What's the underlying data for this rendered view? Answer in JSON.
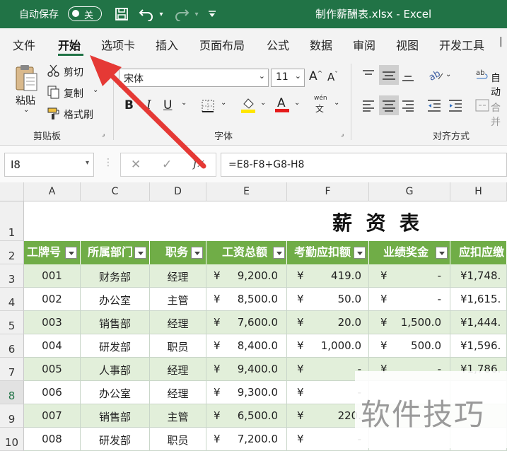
{
  "titlebar": {
    "autosave_label": "自动保存",
    "autosave_state": "关",
    "document_title": "制作薪酬表.xlsx  -  Excel",
    "bg_color": "#217346"
  },
  "tabs": [
    "文件",
    "开始",
    "选项卡",
    "插入",
    "页面布局",
    "公式",
    "数据",
    "审阅",
    "视图",
    "开发工具"
  ],
  "active_tab": "开始",
  "ribbon": {
    "clipboard": {
      "paste": "粘贴",
      "cut": "剪切",
      "copy": "复制",
      "format_painter": "格式刷",
      "group": "剪贴板"
    },
    "font": {
      "font_name": "宋体",
      "font_size": "11",
      "group": "字体",
      "pinyin": "wén",
      "pinyin_char": "文"
    },
    "alignment": {
      "wrap": "自动",
      "merge": "合并",
      "group": "对齐方式"
    }
  },
  "formula_bar": {
    "name_box": "I8",
    "formula": "=E8-F8+G8-H8",
    "fx": "fx"
  },
  "columns": [
    "A",
    "C",
    "D",
    "E",
    "F",
    "G",
    "H"
  ],
  "rows": [
    "1",
    "2",
    "3",
    "4",
    "5",
    "6",
    "7",
    "8",
    "9",
    "10"
  ],
  "selected_row": "8",
  "sheet_title": "薪  资  表",
  "headers": [
    "工牌号",
    "所属部门",
    "职务",
    "工资总额",
    "考勤应扣额",
    "业绩奖金",
    "应扣应缴"
  ],
  "data_rows": [
    [
      "001",
      "财务部",
      "经理",
      "¥",
      "9,200.0",
      "¥",
      "419.0",
      "¥",
      "-",
      "¥1,748."
    ],
    [
      "002",
      "办公室",
      "主管",
      "¥",
      "8,500.0",
      "¥",
      "50.0",
      "¥",
      "-",
      "¥1,615."
    ],
    [
      "003",
      "销售部",
      "经理",
      "¥",
      "7,600.0",
      "¥",
      "20.0",
      "¥",
      "1,500.0",
      "¥1,444."
    ],
    [
      "004",
      "研发部",
      "职员",
      "¥",
      "8,400.0",
      "¥",
      "1,000.0",
      "¥",
      "500.0",
      "¥1,596."
    ],
    [
      "005",
      "人事部",
      "经理",
      "¥",
      "9,400.0",
      "¥",
      "-",
      "¥",
      "-",
      "¥1,786."
    ],
    [
      "006",
      "办公室",
      "经理",
      "¥",
      "9,300.0",
      "¥",
      "-",
      "",
      "",
      ""
    ],
    [
      "007",
      "销售部",
      "主管",
      "¥",
      "6,500.0",
      "¥",
      "220.",
      "",
      "",
      ""
    ],
    [
      "008",
      "研发部",
      "职员",
      "¥",
      "7,200.0",
      "¥",
      "-",
      "",
      "",
      ""
    ]
  ],
  "watermark": "软件技巧",
  "colors": {
    "header_green": "#70ad47",
    "band_green": "#e2efda",
    "arrow_red": "#e53935"
  }
}
